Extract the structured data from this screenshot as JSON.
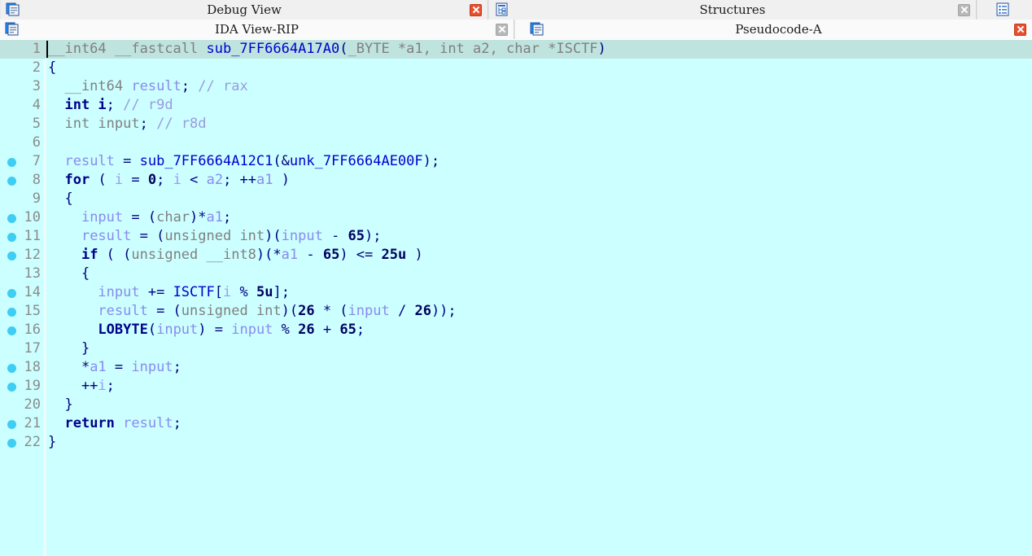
{
  "window": {
    "app": "IDA Pro",
    "background_color": "#ccffff",
    "accent_color": "#3ecdf3",
    "current_line_color": "#bfe3de"
  },
  "tabbar_top": {
    "tabs": [
      {
        "label": "Debug View",
        "icon": "document-icon",
        "active": false,
        "close_icon": "close-icon",
        "close_style": "red"
      },
      {
        "label": "Structures",
        "icon": "structures-icon",
        "active": false,
        "close_icon": "close-icon",
        "close_style": "gray"
      },
      {
        "label": "",
        "icon": "enums-icon",
        "active": false,
        "close_icon": "",
        "close_style": ""
      }
    ]
  },
  "tabbar_bottom": {
    "tabs": [
      {
        "label": "IDA View-RIP",
        "icon": "document-icon",
        "active": false,
        "close_icon": "close-icon",
        "close_style": "gray"
      },
      {
        "label": "Pseudocode-A",
        "icon": "document-icon",
        "active": true,
        "close_icon": "close-icon",
        "close_style": "red"
      }
    ]
  },
  "editor": {
    "title": "Pseudocode-A",
    "current_line": 1,
    "lines": [
      {
        "n": "1",
        "bp": false,
        "cursor": true,
        "current": true,
        "tokens": [
          {
            "t": "__int64 ",
            "c": "pl"
          },
          {
            "t": "__fastcall ",
            "c": "pl"
          },
          {
            "t": "sub_7FF6664A17A0",
            "c": "fn"
          },
          {
            "t": "(",
            "c": "punc"
          },
          {
            "t": "_BYTE *a1, int a2, char *ISCTF",
            "c": "pl"
          },
          {
            "t": ")",
            "c": "punc"
          }
        ]
      },
      {
        "n": "2",
        "bp": false,
        "cursor": false,
        "current": false,
        "tokens": [
          {
            "t": "{",
            "c": "punc"
          }
        ]
      },
      {
        "n": "3",
        "bp": false,
        "cursor": false,
        "current": false,
        "tokens": [
          {
            "t": "  __int64 ",
            "c": "pl"
          },
          {
            "t": "result",
            "c": "var"
          },
          {
            "t": ";",
            "c": "punc"
          },
          {
            "t": " ",
            "c": "pl"
          },
          {
            "t": "// rax",
            "c": "cmt"
          }
        ]
      },
      {
        "n": "4",
        "bp": false,
        "cursor": false,
        "current": false,
        "tokens": [
          {
            "t": "  ",
            "c": "pl"
          },
          {
            "t": "int i",
            "c": "k"
          },
          {
            "t": ";",
            "c": "punc"
          },
          {
            "t": " ",
            "c": "pl"
          },
          {
            "t": "// r9d",
            "c": "cmt"
          }
        ]
      },
      {
        "n": "5",
        "bp": false,
        "cursor": false,
        "current": false,
        "tokens": [
          {
            "t": "  int ",
            "c": "pl"
          },
          {
            "t": "input",
            "c": "pl"
          },
          {
            "t": ";",
            "c": "punc"
          },
          {
            "t": " ",
            "c": "pl"
          },
          {
            "t": "// r8d",
            "c": "cmt"
          }
        ]
      },
      {
        "n": "6",
        "bp": false,
        "cursor": false,
        "current": false,
        "tokens": []
      },
      {
        "n": "7",
        "bp": true,
        "cursor": false,
        "current": false,
        "tokens": [
          {
            "t": "  ",
            "c": "pl"
          },
          {
            "t": "result",
            "c": "var"
          },
          {
            "t": " = ",
            "c": "punc"
          },
          {
            "t": "sub_7FF6664A12C1",
            "c": "fn"
          },
          {
            "t": "(&",
            "c": "punc"
          },
          {
            "t": "unk_7FF6664AE00F",
            "c": "fn"
          },
          {
            "t": ");",
            "c": "punc"
          }
        ]
      },
      {
        "n": "8",
        "bp": true,
        "cursor": false,
        "current": false,
        "tokens": [
          {
            "t": "  ",
            "c": "pl"
          },
          {
            "t": "for",
            "c": "k"
          },
          {
            "t": " ( ",
            "c": "punc"
          },
          {
            "t": "i",
            "c": "arg"
          },
          {
            "t": " = ",
            "c": "punc"
          },
          {
            "t": "0",
            "c": "num"
          },
          {
            "t": "; ",
            "c": "punc"
          },
          {
            "t": "i",
            "c": "arg"
          },
          {
            "t": " < ",
            "c": "punc"
          },
          {
            "t": "a2",
            "c": "var"
          },
          {
            "t": "; ++",
            "c": "punc"
          },
          {
            "t": "a1",
            "c": "var"
          },
          {
            "t": " )",
            "c": "punc"
          }
        ]
      },
      {
        "n": "9",
        "bp": false,
        "cursor": false,
        "current": false,
        "tokens": [
          {
            "t": "  {",
            "c": "punc"
          }
        ]
      },
      {
        "n": "10",
        "bp": true,
        "cursor": false,
        "current": false,
        "tokens": [
          {
            "t": "    ",
            "c": "pl"
          },
          {
            "t": "input",
            "c": "var"
          },
          {
            "t": " = (",
            "c": "punc"
          },
          {
            "t": "char",
            "c": "pl"
          },
          {
            "t": ")*",
            "c": "punc"
          },
          {
            "t": "a1",
            "c": "var"
          },
          {
            "t": ";",
            "c": "punc"
          }
        ]
      },
      {
        "n": "11",
        "bp": true,
        "cursor": false,
        "current": false,
        "tokens": [
          {
            "t": "    ",
            "c": "pl"
          },
          {
            "t": "result",
            "c": "var"
          },
          {
            "t": " = (",
            "c": "punc"
          },
          {
            "t": "unsigned int",
            "c": "pl"
          },
          {
            "t": ")(",
            "c": "punc"
          },
          {
            "t": "input",
            "c": "var"
          },
          {
            "t": " - ",
            "c": "punc"
          },
          {
            "t": "65",
            "c": "num"
          },
          {
            "t": ");",
            "c": "punc"
          }
        ]
      },
      {
        "n": "12",
        "bp": true,
        "cursor": false,
        "current": false,
        "tokens": [
          {
            "t": "    ",
            "c": "pl"
          },
          {
            "t": "if",
            "c": "k"
          },
          {
            "t": " ( (",
            "c": "punc"
          },
          {
            "t": "unsigned __int8",
            "c": "pl"
          },
          {
            "t": ")(*",
            "c": "punc"
          },
          {
            "t": "a1",
            "c": "var"
          },
          {
            "t": " - ",
            "c": "punc"
          },
          {
            "t": "65",
            "c": "num"
          },
          {
            "t": ") <= ",
            "c": "punc"
          },
          {
            "t": "25u",
            "c": "num"
          },
          {
            "t": " )",
            "c": "punc"
          }
        ]
      },
      {
        "n": "13",
        "bp": false,
        "cursor": false,
        "current": false,
        "tokens": [
          {
            "t": "    {",
            "c": "punc"
          }
        ]
      },
      {
        "n": "14",
        "bp": true,
        "cursor": false,
        "current": false,
        "tokens": [
          {
            "t": "      ",
            "c": "pl"
          },
          {
            "t": "input",
            "c": "var"
          },
          {
            "t": " += ",
            "c": "punc"
          },
          {
            "t": "ISCTF",
            "c": "fn"
          },
          {
            "t": "[",
            "c": "punc"
          },
          {
            "t": "i",
            "c": "arg"
          },
          {
            "t": " % ",
            "c": "punc"
          },
          {
            "t": "5u",
            "c": "num"
          },
          {
            "t": "];",
            "c": "punc"
          }
        ]
      },
      {
        "n": "15",
        "bp": true,
        "cursor": false,
        "current": false,
        "tokens": [
          {
            "t": "      ",
            "c": "pl"
          },
          {
            "t": "result",
            "c": "var"
          },
          {
            "t": " = (",
            "c": "punc"
          },
          {
            "t": "unsigned int",
            "c": "pl"
          },
          {
            "t": ")(",
            "c": "punc"
          },
          {
            "t": "26",
            "c": "num"
          },
          {
            "t": " * (",
            "c": "punc"
          },
          {
            "t": "input",
            "c": "var"
          },
          {
            "t": " / ",
            "c": "punc"
          },
          {
            "t": "26",
            "c": "num"
          },
          {
            "t": "));",
            "c": "punc"
          }
        ]
      },
      {
        "n": "16",
        "bp": true,
        "cursor": false,
        "current": false,
        "tokens": [
          {
            "t": "      ",
            "c": "pl"
          },
          {
            "t": "LOBYTE",
            "c": "k"
          },
          {
            "t": "(",
            "c": "punc"
          },
          {
            "t": "input",
            "c": "var"
          },
          {
            "t": ") = ",
            "c": "punc"
          },
          {
            "t": "input",
            "c": "var"
          },
          {
            "t": " % ",
            "c": "punc"
          },
          {
            "t": "26",
            "c": "num"
          },
          {
            "t": " + ",
            "c": "punc"
          },
          {
            "t": "65",
            "c": "num"
          },
          {
            "t": ";",
            "c": "punc"
          }
        ]
      },
      {
        "n": "17",
        "bp": false,
        "cursor": false,
        "current": false,
        "tokens": [
          {
            "t": "    }",
            "c": "punc"
          }
        ]
      },
      {
        "n": "18",
        "bp": true,
        "cursor": false,
        "current": false,
        "tokens": [
          {
            "t": "    *",
            "c": "punc"
          },
          {
            "t": "a1",
            "c": "var"
          },
          {
            "t": " = ",
            "c": "punc"
          },
          {
            "t": "input",
            "c": "var"
          },
          {
            "t": ";",
            "c": "punc"
          }
        ]
      },
      {
        "n": "19",
        "bp": true,
        "cursor": false,
        "current": false,
        "tokens": [
          {
            "t": "    ++",
            "c": "punc"
          },
          {
            "t": "i",
            "c": "arg"
          },
          {
            "t": ";",
            "c": "punc"
          }
        ]
      },
      {
        "n": "20",
        "bp": false,
        "cursor": false,
        "current": false,
        "tokens": [
          {
            "t": "  }",
            "c": "punc"
          }
        ]
      },
      {
        "n": "21",
        "bp": true,
        "cursor": false,
        "current": false,
        "tokens": [
          {
            "t": "  ",
            "c": "pl"
          },
          {
            "t": "return",
            "c": "k"
          },
          {
            "t": " ",
            "c": "punc"
          },
          {
            "t": "result",
            "c": "var"
          },
          {
            "t": ";",
            "c": "punc"
          }
        ]
      },
      {
        "n": "22",
        "bp": true,
        "cursor": false,
        "current": false,
        "tokens": [
          {
            "t": "}",
            "c": "punc"
          }
        ]
      }
    ]
  }
}
